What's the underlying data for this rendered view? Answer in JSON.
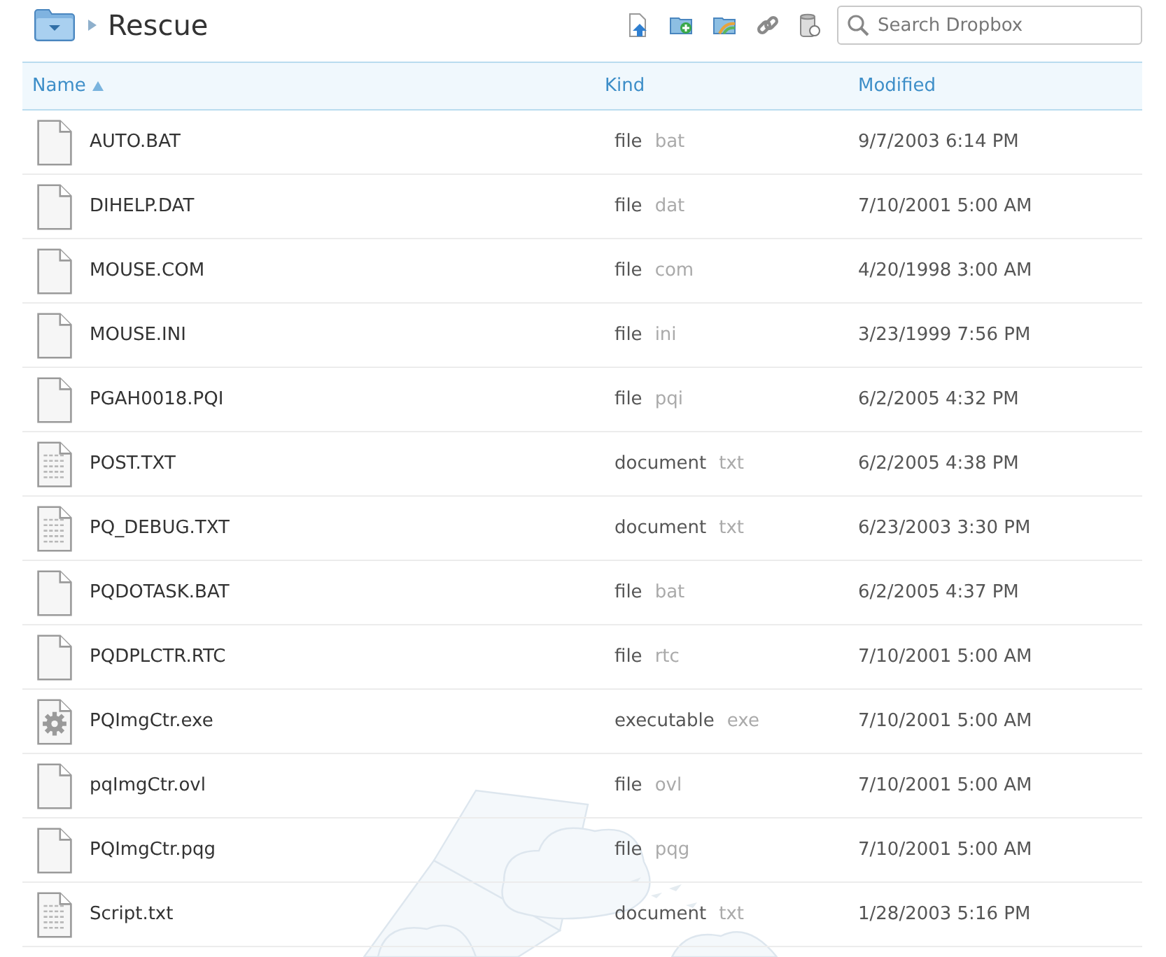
{
  "breadcrumb": {
    "folder": "Rescue"
  },
  "toolbar": {
    "search": {
      "placeholder": "Search Dropbox"
    }
  },
  "table": {
    "columns": [
      {
        "label": "Name",
        "sorted": true
      },
      {
        "label": "Kind",
        "sorted": false
      },
      {
        "label": "Modified",
        "sorted": false
      }
    ],
    "rows": [
      {
        "kind": "blank",
        "name": "AUTO.BAT",
        "type": "file",
        "extension": "bat",
        "modified": "9/7/2003 6:14 PM"
      },
      {
        "kind": "blank",
        "name": "DIHELP.DAT",
        "type": "file",
        "extension": "dat",
        "modified": "7/10/2001 5:00 AM"
      },
      {
        "kind": "blank",
        "name": "MOUSE.COM",
        "type": "file",
        "extension": "com",
        "modified": "4/20/1998 3:00 AM"
      },
      {
        "kind": "blank",
        "name": "MOUSE.INI",
        "type": "file",
        "extension": "ini",
        "modified": "3/23/1999 7:56 PM"
      },
      {
        "kind": "blank",
        "name": "PGAH0018.PQI",
        "type": "file",
        "extension": "pqi",
        "modified": "6/2/2005 4:32 PM"
      },
      {
        "kind": "text",
        "name": "POST.TXT",
        "type": "document",
        "extension": "txt",
        "modified": "6/2/2005 4:38 PM"
      },
      {
        "kind": "text",
        "name": "PQ_DEBUG.TXT",
        "type": "document",
        "extension": "txt",
        "modified": "6/23/2003 3:30 PM"
      },
      {
        "kind": "blank",
        "name": "PQDOTASK.BAT",
        "type": "file",
        "extension": "bat",
        "modified": "6/2/2005 4:37 PM"
      },
      {
        "kind": "blank",
        "name": "PQDPLCTR.RTC",
        "type": "file",
        "extension": "rtc",
        "modified": "7/10/2001 5:00 AM"
      },
      {
        "kind": "exe",
        "name": "PQImgCtr.exe",
        "type": "executable",
        "extension": "exe",
        "modified": "7/10/2001 5:00 AM"
      },
      {
        "kind": "blank",
        "name": "pqImgCtr.ovl",
        "type": "file",
        "extension": "ovl",
        "modified": "7/10/2001 5:00 AM"
      },
      {
        "kind": "blank",
        "name": "PQImgCtr.pqg",
        "type": "file",
        "extension": "pqg",
        "modified": "7/10/2001 5:00 AM"
      },
      {
        "kind": "text",
        "name": "Script.txt",
        "type": "document",
        "extension": "txt",
        "modified": "1/28/2003 5:16 PM"
      }
    ]
  }
}
